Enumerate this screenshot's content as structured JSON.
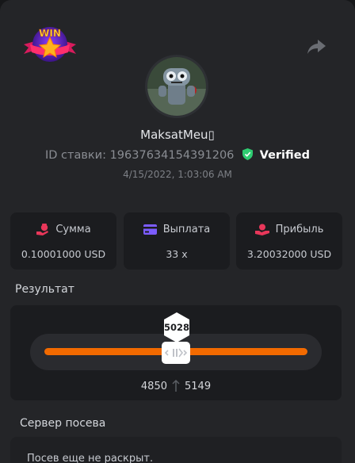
{
  "user": {
    "name": "MaksatMeu▯"
  },
  "bet": {
    "id_label": "ID ставки:",
    "id_value": "19637634154391206",
    "verified_label": "Verified",
    "date": "4/15/2022, 1:03:06 AM"
  },
  "stats": [
    {
      "label": "Сумма",
      "value": "0.10001000 USD",
      "icon": "money-bag-icon"
    },
    {
      "label": "Выплата",
      "value": "33 x",
      "icon": "credit-card-icon"
    },
    {
      "label": "Прибыль",
      "value": "3.20032000 USD",
      "icon": "profit-icon"
    }
  ],
  "result": {
    "title": "Результат",
    "value": "5028",
    "range_low": "4850",
    "range_high": "5149"
  },
  "seed": {
    "title": "Сервер посева",
    "text": "Посев еще не раскрыт."
  },
  "colors": {
    "accent": "#f26a00",
    "verified": "#2ecc71",
    "stat_icon": "#e8375a",
    "card_icon": "#7c5cff"
  }
}
